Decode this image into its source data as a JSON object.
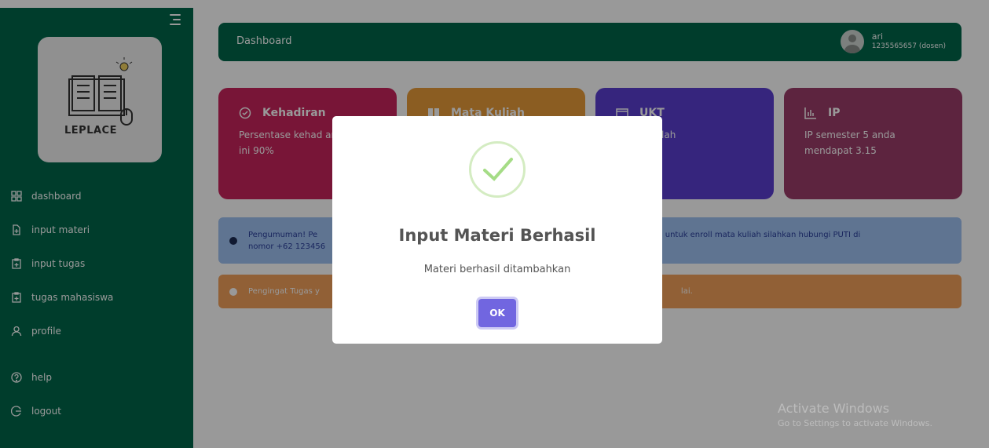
{
  "brand": {
    "logo_text": "LEPLACE"
  },
  "sidebar": {
    "items": [
      {
        "label": "dashboard",
        "icon": "dashboard-icon"
      },
      {
        "label": "input materi",
        "icon": "file-plus-icon"
      },
      {
        "label": "input tugas",
        "icon": "clipboard-plus-icon"
      },
      {
        "label": "tugas mahasiswa",
        "icon": "clipboard-plus-icon"
      },
      {
        "label": "profile",
        "icon": "user-icon"
      },
      {
        "label": "help",
        "icon": "help-icon"
      },
      {
        "label": "logout",
        "icon": "logout-icon"
      }
    ]
  },
  "header": {
    "title": "Dashboard",
    "user_name": "ari",
    "user_id": "1235565657 (dosen)"
  },
  "cards": [
    {
      "title": "Kehadiran",
      "text": "Persentase kehad anda saat ini 90%",
      "color": "#c8235c"
    },
    {
      "title": "Mata Kuliah",
      "text": "",
      "color": "#e89b3a"
    },
    {
      "title": "UKT",
      "text": "ester 5 telah",
      "color": "#5b3fd0"
    },
    {
      "title": "IP",
      "text": "IP semester 5 anda mendapat 3.15",
      "color": "#9b3d6a"
    }
  ],
  "alerts": {
    "announcement_left": "Pengumuman! Pe",
    "announcement_left2": "nomor +62 123456",
    "announcement_right": "rkendala untuk enroll mata kuliah silahkan hubungi PUTI di",
    "reminder_left": "Pengingat Tugas y",
    "reminder_right": "lai."
  },
  "modal": {
    "title": "Input Materi Berhasil",
    "message": "Materi berhasil ditambahkan",
    "ok_label": "OK"
  },
  "watermark": {
    "line1": "Activate Windows",
    "line2": "Go to Settings to activate Windows."
  }
}
